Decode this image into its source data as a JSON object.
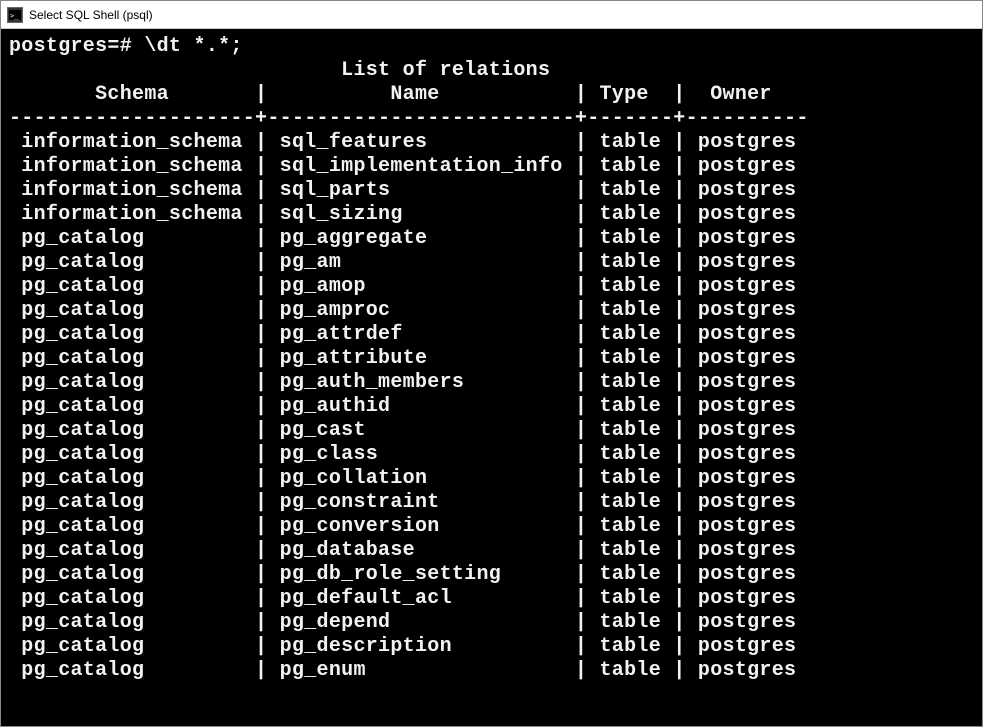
{
  "window": {
    "title": "Select SQL Shell (psql)",
    "icon_glyph": "C:\\"
  },
  "terminal": {
    "prompt": "postgres=# ",
    "command": "\\dt *.*;",
    "table_title": "List of relations",
    "columns": {
      "schema": "Schema",
      "name": "Name",
      "type": "Type",
      "owner": "Owner"
    },
    "widths": {
      "schema": 20,
      "name": 25,
      "type": 7,
      "owner": 10
    },
    "rows": [
      {
        "schema": "information_schema",
        "name": "sql_features",
        "type": "table",
        "owner": "postgres"
      },
      {
        "schema": "information_schema",
        "name": "sql_implementation_info",
        "type": "table",
        "owner": "postgres"
      },
      {
        "schema": "information_schema",
        "name": "sql_parts",
        "type": "table",
        "owner": "postgres"
      },
      {
        "schema": "information_schema",
        "name": "sql_sizing",
        "type": "table",
        "owner": "postgres"
      },
      {
        "schema": "pg_catalog",
        "name": "pg_aggregate",
        "type": "table",
        "owner": "postgres"
      },
      {
        "schema": "pg_catalog",
        "name": "pg_am",
        "type": "table",
        "owner": "postgres"
      },
      {
        "schema": "pg_catalog",
        "name": "pg_amop",
        "type": "table",
        "owner": "postgres"
      },
      {
        "schema": "pg_catalog",
        "name": "pg_amproc",
        "type": "table",
        "owner": "postgres"
      },
      {
        "schema": "pg_catalog",
        "name": "pg_attrdef",
        "type": "table",
        "owner": "postgres"
      },
      {
        "schema": "pg_catalog",
        "name": "pg_attribute",
        "type": "table",
        "owner": "postgres"
      },
      {
        "schema": "pg_catalog",
        "name": "pg_auth_members",
        "type": "table",
        "owner": "postgres"
      },
      {
        "schema": "pg_catalog",
        "name": "pg_authid",
        "type": "table",
        "owner": "postgres"
      },
      {
        "schema": "pg_catalog",
        "name": "pg_cast",
        "type": "table",
        "owner": "postgres"
      },
      {
        "schema": "pg_catalog",
        "name": "pg_class",
        "type": "table",
        "owner": "postgres"
      },
      {
        "schema": "pg_catalog",
        "name": "pg_collation",
        "type": "table",
        "owner": "postgres"
      },
      {
        "schema": "pg_catalog",
        "name": "pg_constraint",
        "type": "table",
        "owner": "postgres"
      },
      {
        "schema": "pg_catalog",
        "name": "pg_conversion",
        "type": "table",
        "owner": "postgres"
      },
      {
        "schema": "pg_catalog",
        "name": "pg_database",
        "type": "table",
        "owner": "postgres"
      },
      {
        "schema": "pg_catalog",
        "name": "pg_db_role_setting",
        "type": "table",
        "owner": "postgres"
      },
      {
        "schema": "pg_catalog",
        "name": "pg_default_acl",
        "type": "table",
        "owner": "postgres"
      },
      {
        "schema": "pg_catalog",
        "name": "pg_depend",
        "type": "table",
        "owner": "postgres"
      },
      {
        "schema": "pg_catalog",
        "name": "pg_description",
        "type": "table",
        "owner": "postgres"
      },
      {
        "schema": "pg_catalog",
        "name": "pg_enum",
        "type": "table",
        "owner": "postgres"
      }
    ]
  }
}
